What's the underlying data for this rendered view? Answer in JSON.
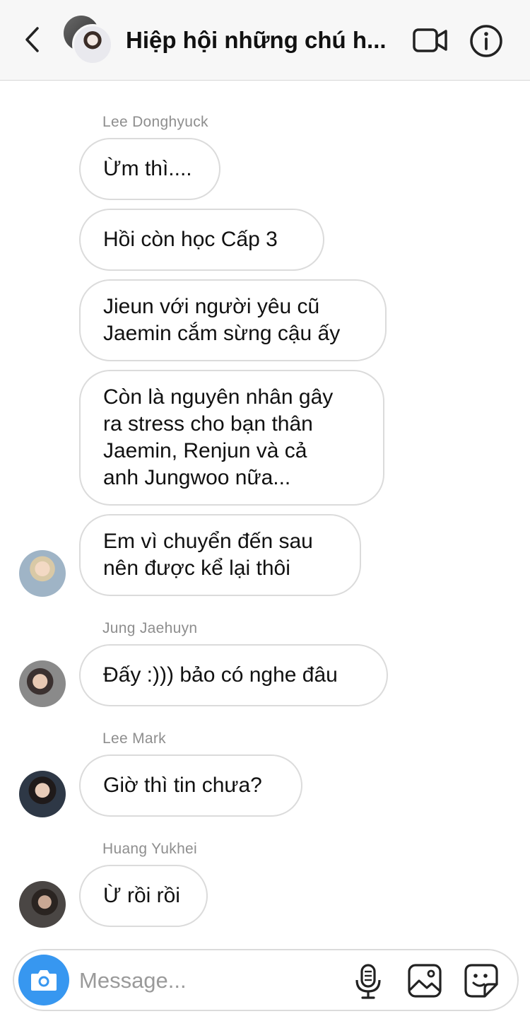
{
  "header": {
    "title": "Hiệp hội những chú h...",
    "back_icon": "chevron-left-icon",
    "video_icon": "video-camera-icon",
    "info_icon": "info-icon"
  },
  "messages": [
    {
      "sender": "Lee Donghyuck",
      "text": "Ừm thì...."
    },
    {
      "text": "Hồi còn học Cấp 3"
    },
    {
      "text": "Jieun với người yêu cũ\nJaemin cắm sừng cậu ấy"
    },
    {
      "text": "Còn là nguyên nhân gây\nra stress cho bạn thân\nJaemin, Renjun và cả\nanh Jungwoo nữa..."
    },
    {
      "text": "Em vì chuyển đến sau\nnên được kể lại thôi"
    },
    {
      "sender": "Jung Jaehuyn",
      "text": "Đấy :))) bảo có nghe đâu"
    },
    {
      "sender": "Lee Mark",
      "text": "Giờ thì tin chưa?"
    },
    {
      "sender": "Huang Yukhei",
      "text": "Ừ rồi rồi"
    }
  ],
  "composer": {
    "placeholder": "Message...",
    "camera_icon": "camera-icon",
    "mic_icon": "microphone-icon",
    "gallery_icon": "image-gallery-icon",
    "sticker_icon": "sticker-icon"
  },
  "colors": {
    "accent": "#3797f0",
    "bubble_border": "#dbdbdb",
    "sender_name": "#8e8e8e",
    "header_bg": "#f7f7f7"
  }
}
